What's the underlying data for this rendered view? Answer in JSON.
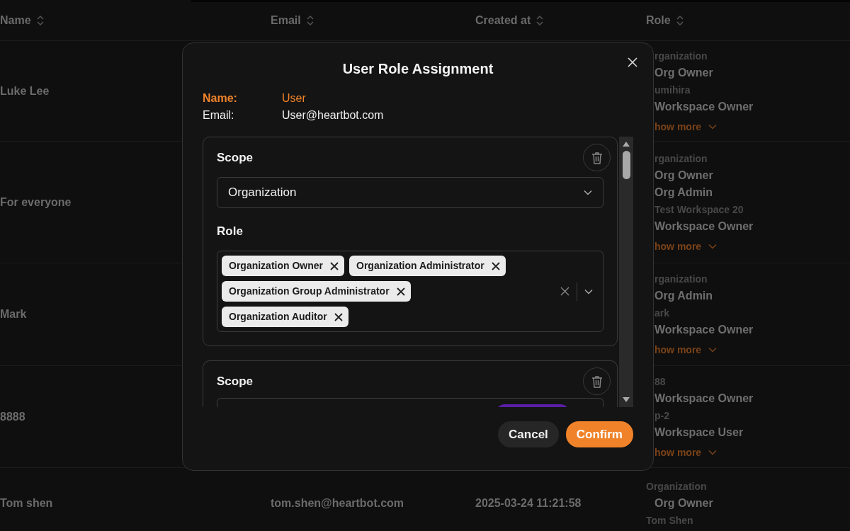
{
  "table": {
    "columns": [
      {
        "label": "Name"
      },
      {
        "label": "Email"
      },
      {
        "label": "Created at"
      },
      {
        "label": "Role"
      }
    ],
    "rows": [
      {
        "name": "Luke Lee",
        "covered": true,
        "role_lines": [
          {
            "kind": "scope",
            "text": "rganization"
          },
          {
            "kind": "role",
            "text": "Org Owner"
          },
          {
            "kind": "scope",
            "text": "umihira"
          },
          {
            "kind": "role",
            "text": "Workspace Owner"
          },
          {
            "kind": "more",
            "text": "how more"
          }
        ]
      },
      {
        "name": "For everyone",
        "covered": true,
        "role_lines": [
          {
            "kind": "scope",
            "text": "rganization"
          },
          {
            "kind": "role",
            "text": "Org Owner"
          },
          {
            "kind": "role",
            "text": "Org Admin"
          },
          {
            "kind": "scope",
            "text": "Test Workspace 20"
          },
          {
            "kind": "role",
            "text": "Workspace Owner"
          },
          {
            "kind": "more",
            "text": "how more"
          }
        ]
      },
      {
        "name": "Mark",
        "covered": true,
        "role_lines": [
          {
            "kind": "scope",
            "text": "rganization"
          },
          {
            "kind": "role",
            "text": "Org Admin"
          },
          {
            "kind": "scope",
            "text": "ark"
          },
          {
            "kind": "role",
            "text": "Workspace Owner"
          },
          {
            "kind": "more",
            "text": "how more"
          }
        ]
      },
      {
        "name": "8888",
        "covered": true,
        "role_lines": [
          {
            "kind": "scope",
            "text": "88"
          },
          {
            "kind": "role",
            "text": "Workspace Owner"
          },
          {
            "kind": "scope",
            "text": "p-2"
          },
          {
            "kind": "role",
            "text": "Workspace User"
          },
          {
            "kind": "more",
            "text": "how more"
          }
        ]
      },
      {
        "name": "Tom shen",
        "email": "tom.shen@heartbot.com",
        "created_at": "2025-03-24 11:21:58",
        "covered": false,
        "role_lines": [
          {
            "kind": "scope",
            "text": "Organization"
          },
          {
            "kind": "role",
            "text": "Org Owner"
          },
          {
            "kind": "scope",
            "text": "Tom Shen"
          }
        ]
      }
    ]
  },
  "dialog": {
    "title": "User Role Assignment",
    "fields": [
      {
        "label": "Name:",
        "value": "User",
        "highlight": true
      },
      {
        "label": "Email:",
        "value": "User@heartbot.com",
        "highlight": false
      }
    ],
    "cards": [
      {
        "kind": "full",
        "scope_label": "Scope",
        "scope_value": "Organization",
        "role_label": "Role",
        "roles": [
          "Organization Owner",
          "Organization Administrator",
          "Organization Group Administrator",
          "Organization Auditor"
        ]
      },
      {
        "kind": "cut",
        "scope_label": "Scope"
      }
    ],
    "buttons": [
      {
        "label": "Cancel",
        "kind": "secondary"
      },
      {
        "label": "Confirm",
        "kind": "primary"
      }
    ]
  }
}
